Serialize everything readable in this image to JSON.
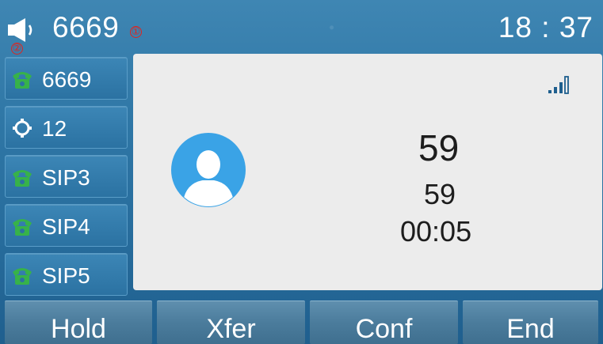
{
  "topbar": {
    "account": "6669",
    "time": "18 : 37",
    "speaker_icon": "speakerphone-icon"
  },
  "markers": [
    "①",
    "②",
    "③",
    "④",
    "⑤",
    "⑥"
  ],
  "linekeys": [
    {
      "label": "6669",
      "icon": "phone-icon"
    },
    {
      "label": "12",
      "icon": "dnd-icon"
    },
    {
      "label": "SIP3",
      "icon": "phone-icon"
    },
    {
      "label": "SIP4",
      "icon": "phone-icon"
    },
    {
      "label": "SIP5",
      "icon": "phone-icon"
    }
  ],
  "call": {
    "name": "59",
    "number": "59",
    "duration": "00:05",
    "avatar_icon": "contact-avatar-icon",
    "signal_icon": "hd-signal-icon"
  },
  "softkeys": [
    {
      "label": "Hold"
    },
    {
      "label": "Xfer"
    },
    {
      "label": "Conf"
    },
    {
      "label": "End"
    }
  ],
  "colors": {
    "background": "#2f77a6",
    "panel": "#ececec",
    "avatar": "#3aa3e6",
    "line_icon": "#37b24a",
    "marker": "#e0241e"
  }
}
